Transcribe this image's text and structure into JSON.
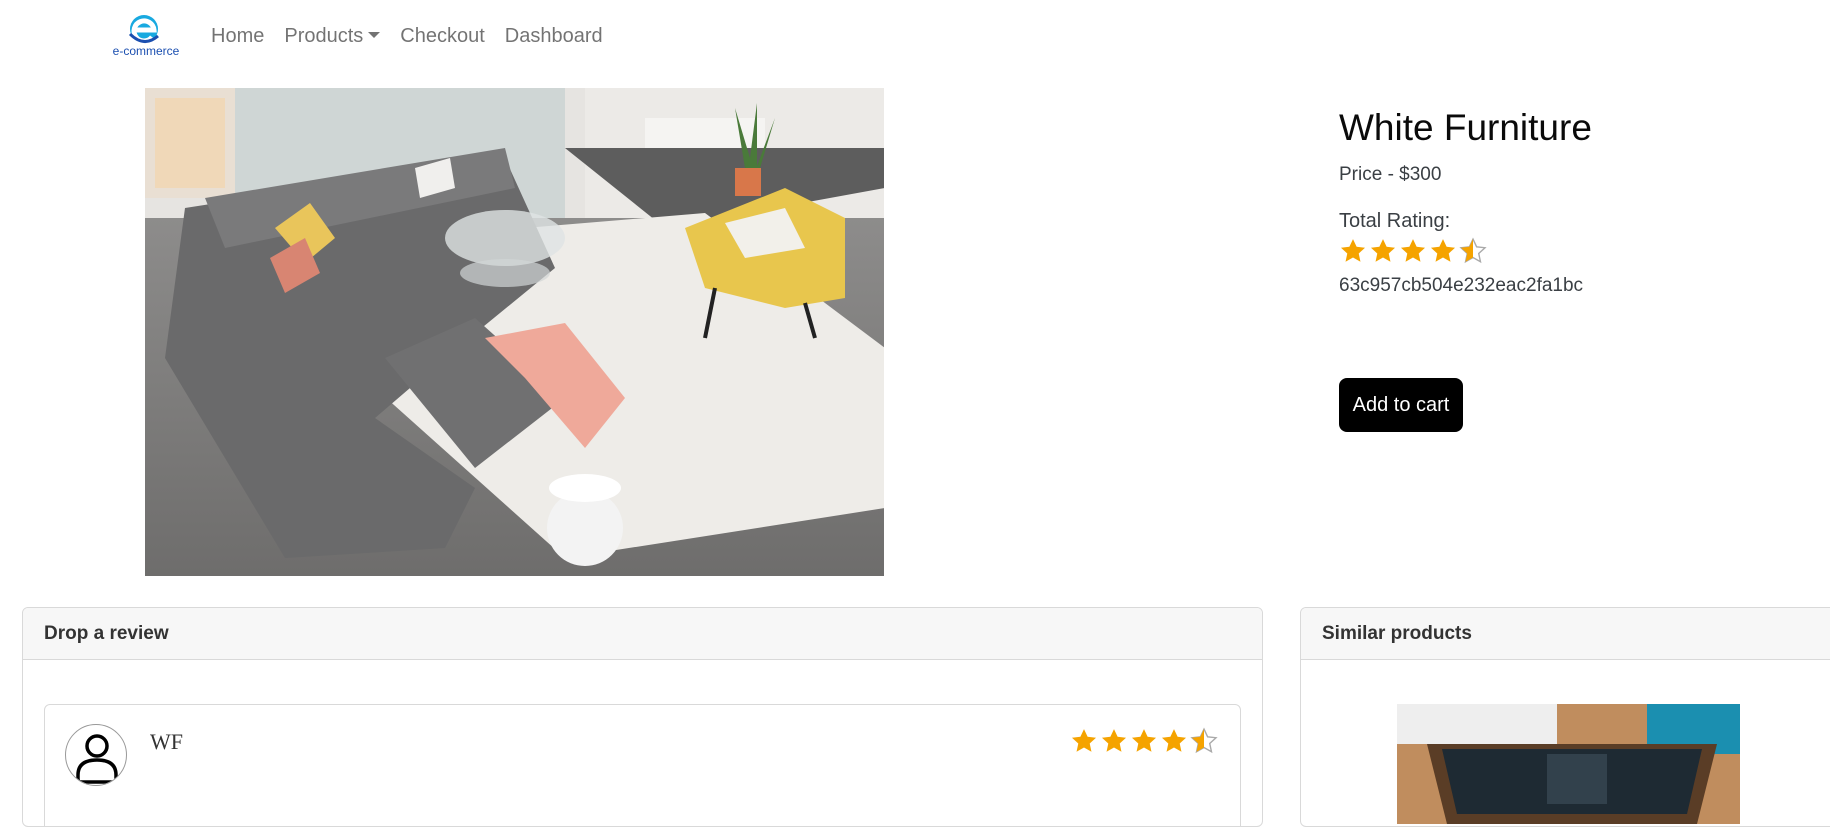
{
  "navbar": {
    "brand_text": "e-commerce",
    "links": [
      "Home",
      "Products",
      "Checkout",
      "Dashboard"
    ]
  },
  "product": {
    "title": "White Furniture",
    "price": "Price - $300",
    "rating_label": "Total Rating:",
    "rating": 4.5,
    "id": "63c957cb504e232eac2fa1bc",
    "add_to_cart": "Add to cart"
  },
  "review_section": {
    "header": "Drop a review",
    "reviews": [
      {
        "name": "WF",
        "rating": 4.5
      }
    ]
  },
  "similar_section": {
    "header": "Similar products"
  },
  "colors": {
    "star": "#f5a300",
    "button": "#000000",
    "brand": "#1b4fb0"
  }
}
